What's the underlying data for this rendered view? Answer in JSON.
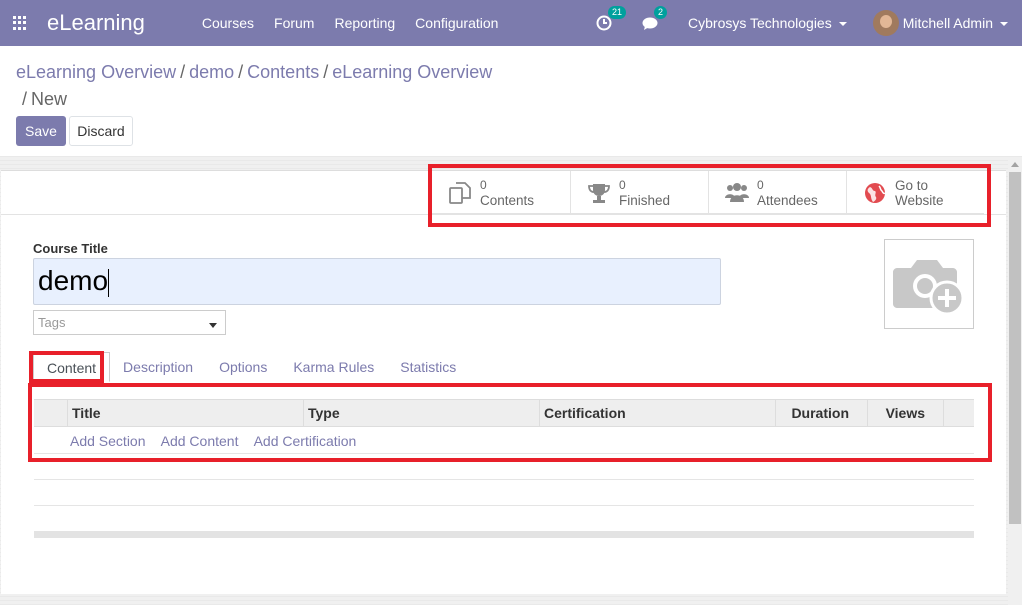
{
  "navbar": {
    "brand": "eLearning",
    "menu": [
      "Courses",
      "Forum",
      "Reporting",
      "Configuration"
    ],
    "activity_count": "21",
    "messages_count": "2",
    "company": "Cybrosys Technologies",
    "user": "Mitchell Admin"
  },
  "breadcrumb": {
    "items": [
      "eLearning Overview",
      "demo",
      "Contents",
      "eLearning Overview"
    ],
    "current": "New"
  },
  "actions": {
    "save": "Save",
    "discard": "Discard"
  },
  "smart_buttons": [
    {
      "value": "0",
      "label": "Contents"
    },
    {
      "value": "0",
      "label": "Finished"
    },
    {
      "value": "0",
      "label": "Attendees"
    },
    {
      "value": "Go to",
      "label": "Website"
    }
  ],
  "form": {
    "course_title_label": "Course Title",
    "course_title_value": "demo",
    "tags_placeholder": "Tags"
  },
  "tabs": [
    "Content",
    "Description",
    "Options",
    "Karma Rules",
    "Statistics"
  ],
  "table": {
    "columns": [
      "Title",
      "Type",
      "Certification",
      "Duration",
      "Views"
    ],
    "add_links": [
      "Add Section",
      "Add Content",
      "Add Certification"
    ]
  },
  "colors": {
    "brand": "#7c7bad",
    "highlight": "#e8202a",
    "badge": "#00a09d"
  }
}
